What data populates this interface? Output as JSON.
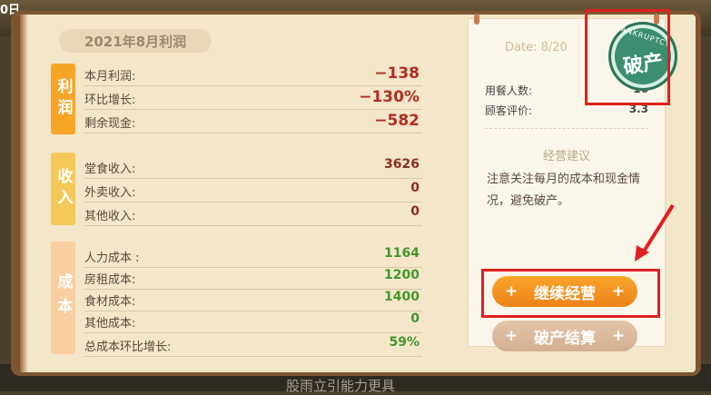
{
  "header": {
    "corner_text": "0日"
  },
  "report": {
    "title": "2021年8月利润",
    "sections": {
      "profit": {
        "tag": "利润",
        "rows": [
          {
            "label": "本月利润:",
            "value": "−138"
          },
          {
            "label": "环比增长:",
            "value": "−130%"
          },
          {
            "label": "剩余现金:",
            "value": "−582"
          }
        ]
      },
      "income": {
        "tag": "收入",
        "rows": [
          {
            "label": "堂食收入:",
            "value": "3626"
          },
          {
            "label": "外卖收入:",
            "value": "0"
          },
          {
            "label": "其他收入:",
            "value": "0"
          }
        ]
      },
      "cost": {
        "tag": "成本",
        "rows": [
          {
            "label": "人力成本 :",
            "value": "1164"
          },
          {
            "label": "房租成本:",
            "value": "1200"
          },
          {
            "label": "食材成本:",
            "value": "1400"
          },
          {
            "label": "其他成本:",
            "value": "0"
          },
          {
            "label": "总成本环比增长:",
            "value": "59%"
          }
        ]
      }
    }
  },
  "receipt": {
    "date": "Date: 8/20",
    "diners_label": "用餐人数:",
    "diners_value": "16",
    "rating_label": "顾客评价:",
    "rating_value": "3.3",
    "advice_title": "经营建议",
    "advice_text": "注意关注每月的成本和现金情况，避免破产。"
  },
  "stamp": {
    "top_text": "BANKRUPTCY",
    "main_text": "破产"
  },
  "buttons": {
    "continue": "继续经营",
    "bankrupt": "破产结算",
    "plus": "+"
  },
  "bottom_text": "股雨立引能力更具"
}
